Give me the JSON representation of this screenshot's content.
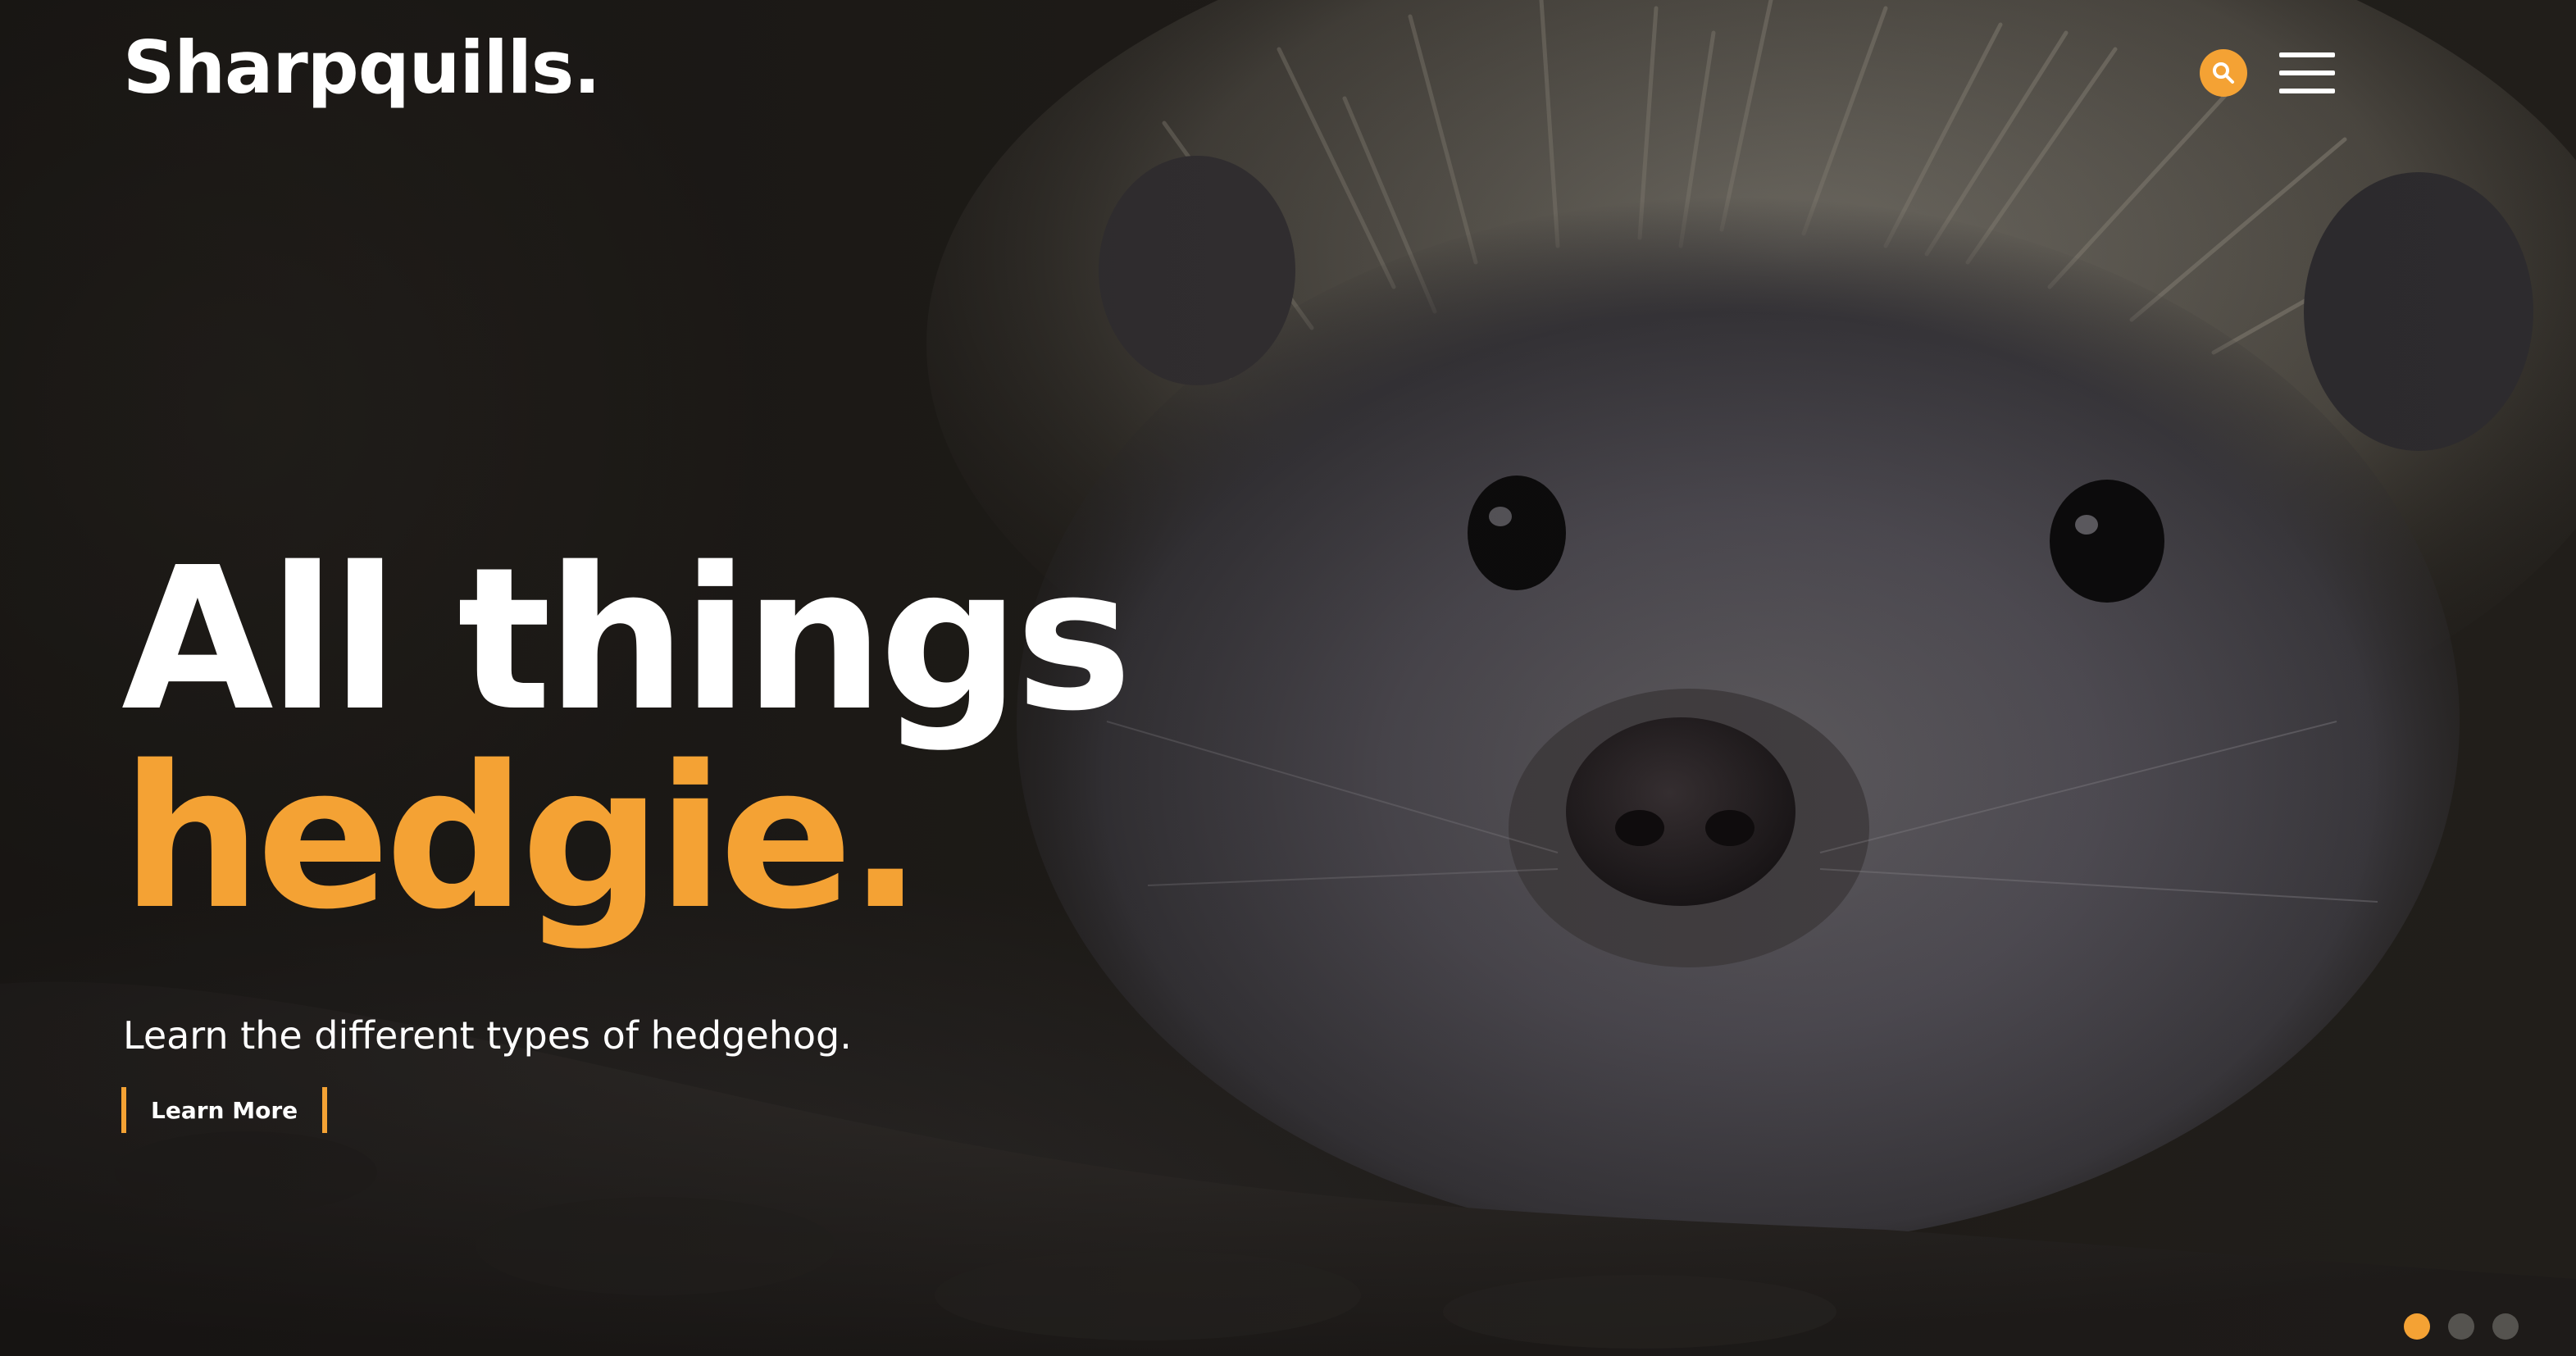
{
  "brand": {
    "logo_text": "Sharpquills.",
    "accent_color": "#f4a234"
  },
  "header": {
    "search_icon": "search-icon",
    "menu_icon": "hamburger-menu-icon"
  },
  "hero": {
    "headline_line1": "All things",
    "headline_line2": "hedgie.",
    "subtitle": "Learn the different types of hedgehog.",
    "cta_label": "Learn More",
    "background_image": "hedgehog close-up photo"
  },
  "carousel": {
    "slide_count": 3,
    "active_index": 0
  }
}
